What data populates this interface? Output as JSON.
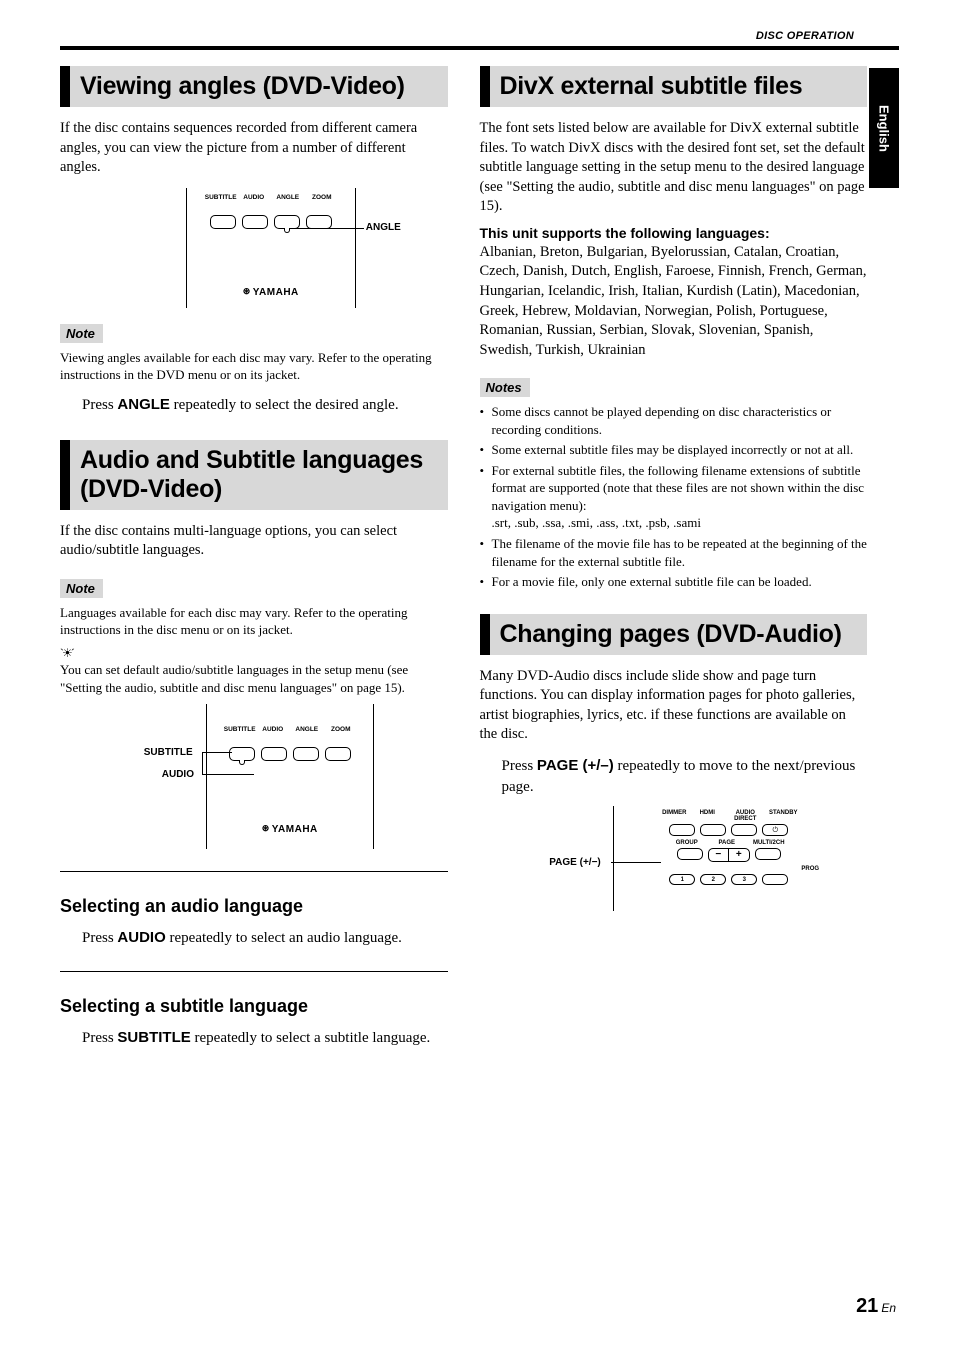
{
  "header": {
    "section_label": "DISC OPERATION",
    "side_tab": "English"
  },
  "left": {
    "s1": {
      "title": "Viewing angles (DVD-Video)",
      "intro": "If the disc contains sequences recorded from different camera angles, you can view the picture from a number of different angles.",
      "remote": {
        "btn_labels": [
          "SUBTITLE",
          "AUDIO",
          "ANGLE",
          "ZOOM"
        ],
        "logo": "YAMAHA",
        "callout": "ANGLE"
      },
      "note_label": "Note",
      "note_text": "Viewing angles available for each disc may vary. Refer to the operating instructions in the DVD menu or on its jacket.",
      "step_pre": "Press ",
      "step_bold": "ANGLE",
      "step_post": " repeatedly to select the desired angle."
    },
    "s2": {
      "title_l1": "Audio and Subtitle languages",
      "title_l2": "(DVD-Video)",
      "intro": "If the disc contains multi-language options, you can select audio/subtitle languages.",
      "note_label": "Note",
      "note_text": "Languages available for each disc may vary. Refer to the operating instructions in the disc menu or on its jacket.",
      "tip": "You can set default audio/subtitle languages in the setup menu (see \"Setting the audio, subtitle and disc menu languages\" on page 15).",
      "remote": {
        "btn_labels": [
          "SUBTITLE",
          "AUDIO",
          "ANGLE",
          "ZOOM"
        ],
        "logo": "YAMAHA",
        "callout_sub": "SUBTITLE",
        "callout_aud": "AUDIO"
      },
      "sub_audio": {
        "heading": "Selecting an audio language",
        "step_pre": "Press ",
        "step_bold": "AUDIO",
        "step_post": " repeatedly to select an audio language."
      },
      "sub_subtitle": {
        "heading": "Selecting a subtitle language",
        "step_pre": "Press ",
        "step_bold": "SUBTITLE",
        "step_post": " repeatedly to select a subtitle language."
      }
    }
  },
  "right": {
    "s1": {
      "title": "DivX external subtitle files",
      "intro": "The font sets listed below are available for DivX external subtitle files. To watch DivX discs with the desired font set, set the default subtitle language setting in the setup menu to the desired language (see \"Setting the audio, subtitle and disc menu languages\" on page 15).",
      "bold_line": "This unit supports the following languages:",
      "langs": "Albanian, Breton, Bulgarian, Byelorussian, Catalan, Croatian, Czech, Danish, Dutch, English, Faroese, Finnish, French, German, Hungarian, Icelandic, Irish, Italian, Kurdish (Latin), Macedonian, Greek, Hebrew, Moldavian, Norwegian, Polish, Portuguese, Romanian, Russian, Serbian, Slovak, Slovenian, Spanish, Swedish, Turkish, Ukrainian",
      "notes_label": "Notes",
      "notes": [
        "Some discs cannot be played depending on disc characteristics or recording conditions.",
        "Some external subtitle files may be displayed incorrectly or not at all.",
        "For external subtitle files, the following filename extensions of subtitle format are supported (note that these files are not shown within the disc navigation menu):\n.srt, .sub, .ssa, .smi, .ass, .txt, .psb, .sami",
        "The filename of the movie file has to be repeated at the beginning of the filename for the external subtitle file.",
        "For a movie file, only one external subtitle file can be loaded."
      ]
    },
    "s2": {
      "title": "Changing pages (DVD-Audio)",
      "intro": "Many DVD-Audio discs include slide show and page turn functions. You can display information pages for photo galleries, artist biographies, lyrics, etc. if these functions are available on the disc.",
      "step_pre": "Press ",
      "step_bold": "PAGE (+/–)",
      "step_post": " repeatedly to move to the next/previous page.",
      "remote": {
        "row1_labels": [
          "DIMMER",
          "HDMI",
          "AUDIO DIRECT",
          "STANDBY"
        ],
        "row2_labels": [
          "GROUP",
          "PAGE",
          "MULTI/2CH"
        ],
        "row3_right": "PROG",
        "nums": [
          "1",
          "2",
          "3"
        ],
        "callout": "PAGE (+/−)"
      }
    }
  },
  "footer": {
    "page": "21",
    "lang": "En"
  }
}
